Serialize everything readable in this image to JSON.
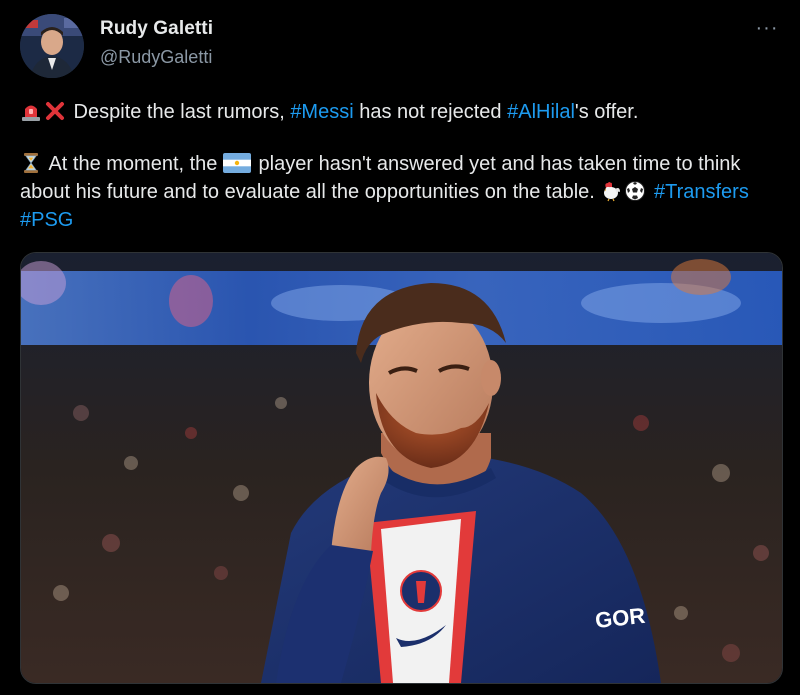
{
  "author": {
    "name": "Rudy Galetti",
    "handle": "@RudyGaletti",
    "avatar_icon": "avatar-photo"
  },
  "more_icon": "more-options-icon",
  "more_label": "···",
  "tweet": {
    "p1": {
      "emoji1": "police-light-icon",
      "emoji2": "cross-mark-icon",
      "t1": " Despite the last rumors, ",
      "tag1": "#Messi",
      "t2": " has not rejected ",
      "tag2": "#AlHilal",
      "t3": "'s offer."
    },
    "p2": {
      "emoji1": "hourglass-icon",
      "t1": " At the moment, the ",
      "flag": "argentina-flag-icon",
      "t2": " player hasn't answered yet and has taken time to think about his future and to evaluate all the opportunities on the table. ",
      "emoji2": "rooster-icon",
      "emoji3": "soccer-ball-icon",
      "tag1": "#Transfers",
      "tag2": "#PSG"
    }
  },
  "media": {
    "shirt_text": "GOR"
  },
  "colors": {
    "background": "#000000",
    "text": "#e7e9ea",
    "secondary": "#8b98a5",
    "link": "#1d9bf0"
  }
}
